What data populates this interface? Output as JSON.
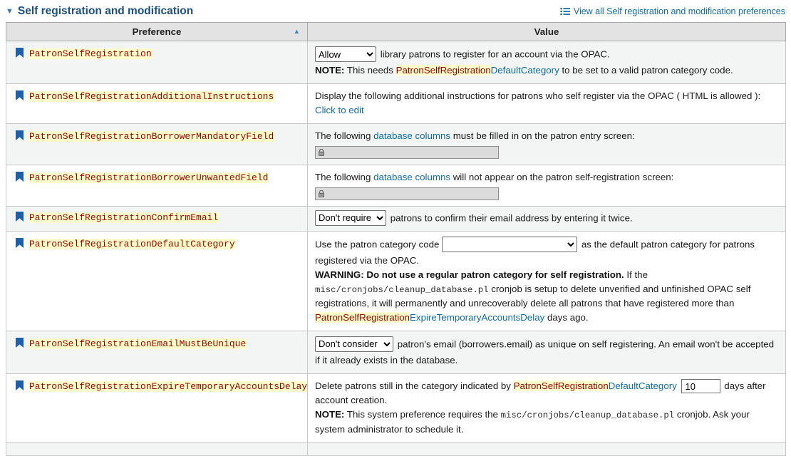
{
  "header": {
    "collapse_icon": "▼",
    "title": "Self registration and modification",
    "view_all_label": "View all Self registration and modification preferences"
  },
  "table": {
    "preference_header": "Preference",
    "value_header": "Value",
    "sort_asc_icon": "▲"
  },
  "colors": {
    "title_text": "#1c4e7e",
    "link": "#0e6ba8",
    "term_text": "#990000",
    "term_background": "#ffffcc",
    "bookmark_icon": "#1f5fa8",
    "header_background": "#e3e3e3",
    "row_stripe": "#f3f4f4",
    "locked_input_background": "#dbdbdb"
  },
  "rows": [
    {
      "name": "PatronSelfRegistration",
      "select_value": "Allow",
      "text_after_select": "library patrons to register for an account via the OPAC.",
      "note_label": "NOTE:",
      "note_pre": "This needs",
      "ref_highlight": "PatronSelfRegistration",
      "ref_rest": "DefaultCategory",
      "note_post": "to be set to a valid patron category code."
    },
    {
      "name": "PatronSelfRegistrationAdditionalInstructions",
      "line1": "Display the following additional instructions for patrons who self register via the OPAC ( HTML is allowed ):",
      "edit_link": "Click to edit"
    },
    {
      "name": "PatronSelfRegistrationBorrowerMandatoryField",
      "pre_link": "The following",
      "link": "database columns",
      "post_link": "must be filled in on the patron entry screen:"
    },
    {
      "name": "PatronSelfRegistrationBorrowerUnwantedField",
      "pre_link": "The following",
      "link": "database columns",
      "post_link": "will not appear on the patron self-registration screen:"
    },
    {
      "name": "PatronSelfRegistrationConfirmEmail",
      "select_value": "Don't require",
      "text_after_select": "patrons to confirm their email address by entering it twice."
    },
    {
      "name": "PatronSelfRegistrationDefaultCategory",
      "pre_select": "Use the patron category code",
      "select_value": "",
      "post_select": "as the default patron category for patrons registered via the OPAC.",
      "warning_label": "WARNING: Do not use a regular patron category for self registration.",
      "warning_pre": "If the",
      "code_path": "misc/cronjobs/cleanup_database.pl",
      "warning_mid": "cronjob is setup to delete unverified and unfinished OPAC self registrations, it will permanently and unrecoverably delete all patrons that have registered more than",
      "ref_highlight": "PatronSelfRegistration",
      "ref_rest": "ExpireTemporaryAccountsDelay",
      "warning_post": "days ago."
    },
    {
      "name": "PatronSelfRegistrationEmailMustBeUnique",
      "select_value": "Don't consider",
      "text_after_select": "patron's email (borrowers.email) as unique on self registering. An email won't be accepted if it already exists in the database."
    },
    {
      "name": "PatronSelfRegistrationExpireTemporaryAccountsDelay",
      "pre_ref": "Delete patrons still in the category indicated by",
      "ref_highlight": "PatronSelfRegistration",
      "ref_rest": "DefaultCategory",
      "input_value": "10",
      "post_input": "days after account creation.",
      "note_label": "NOTE:",
      "note_pre": "This system preference requires the",
      "code_path": "misc/cronjobs/cleanup_database.pl",
      "note_post": "cronjob. Ask your system administrator to schedule it."
    }
  ]
}
